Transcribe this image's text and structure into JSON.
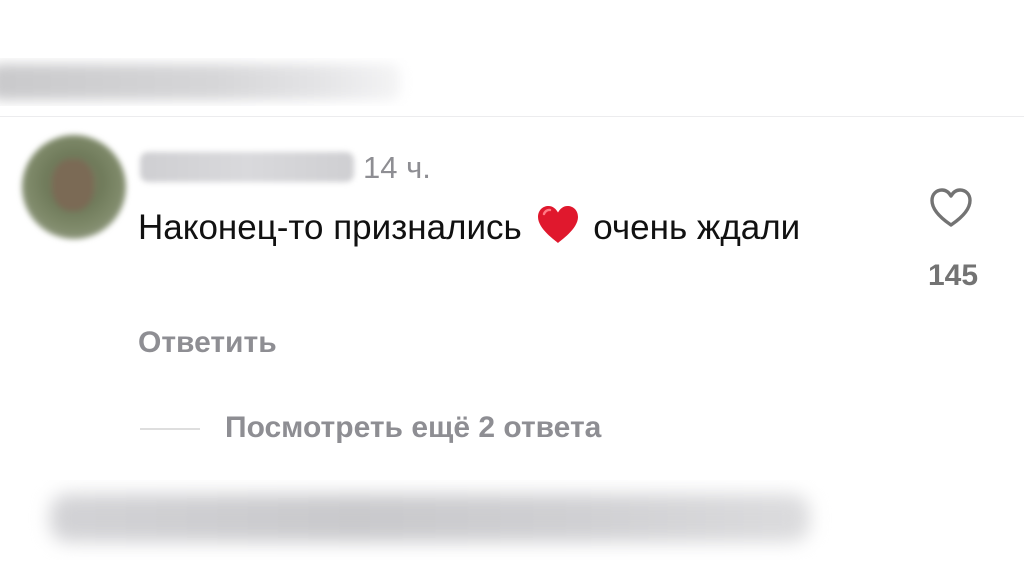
{
  "comment": {
    "timestamp": "14 ч.",
    "text_part1": "Наконец-то признались",
    "emoji": "red-heart-emoji",
    "text_part2": "очень ждали",
    "likes": "145",
    "reply_label": "Ответить"
  },
  "replies": {
    "view_label": "Посмотреть ещё 2 ответа"
  },
  "colors": {
    "text": "#111111",
    "muted": "#8e8e93",
    "like_count": "#737373",
    "heart_emoji": "#e0182d",
    "divider": "#ececee"
  }
}
